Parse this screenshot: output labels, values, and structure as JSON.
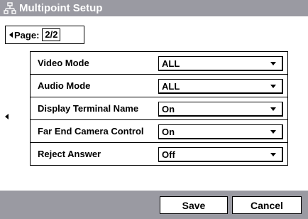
{
  "window": {
    "title": "Multipoint Setup",
    "icon": "network-icon"
  },
  "pagination": {
    "label": "Page:",
    "value": "2/2"
  },
  "settings": [
    {
      "label": "Video Mode",
      "value": "ALL"
    },
    {
      "label": "Audio Mode",
      "value": "ALL"
    },
    {
      "label": "Display Terminal Name",
      "value": "On"
    },
    {
      "label": "Far End Camera Control",
      "value": "On"
    },
    {
      "label": "Reject Answer",
      "value": "Off"
    }
  ],
  "buttons": {
    "save": "Save",
    "cancel": "Cancel"
  },
  "colors": {
    "bar": "#9a9aa2",
    "background": "#ffffff"
  }
}
